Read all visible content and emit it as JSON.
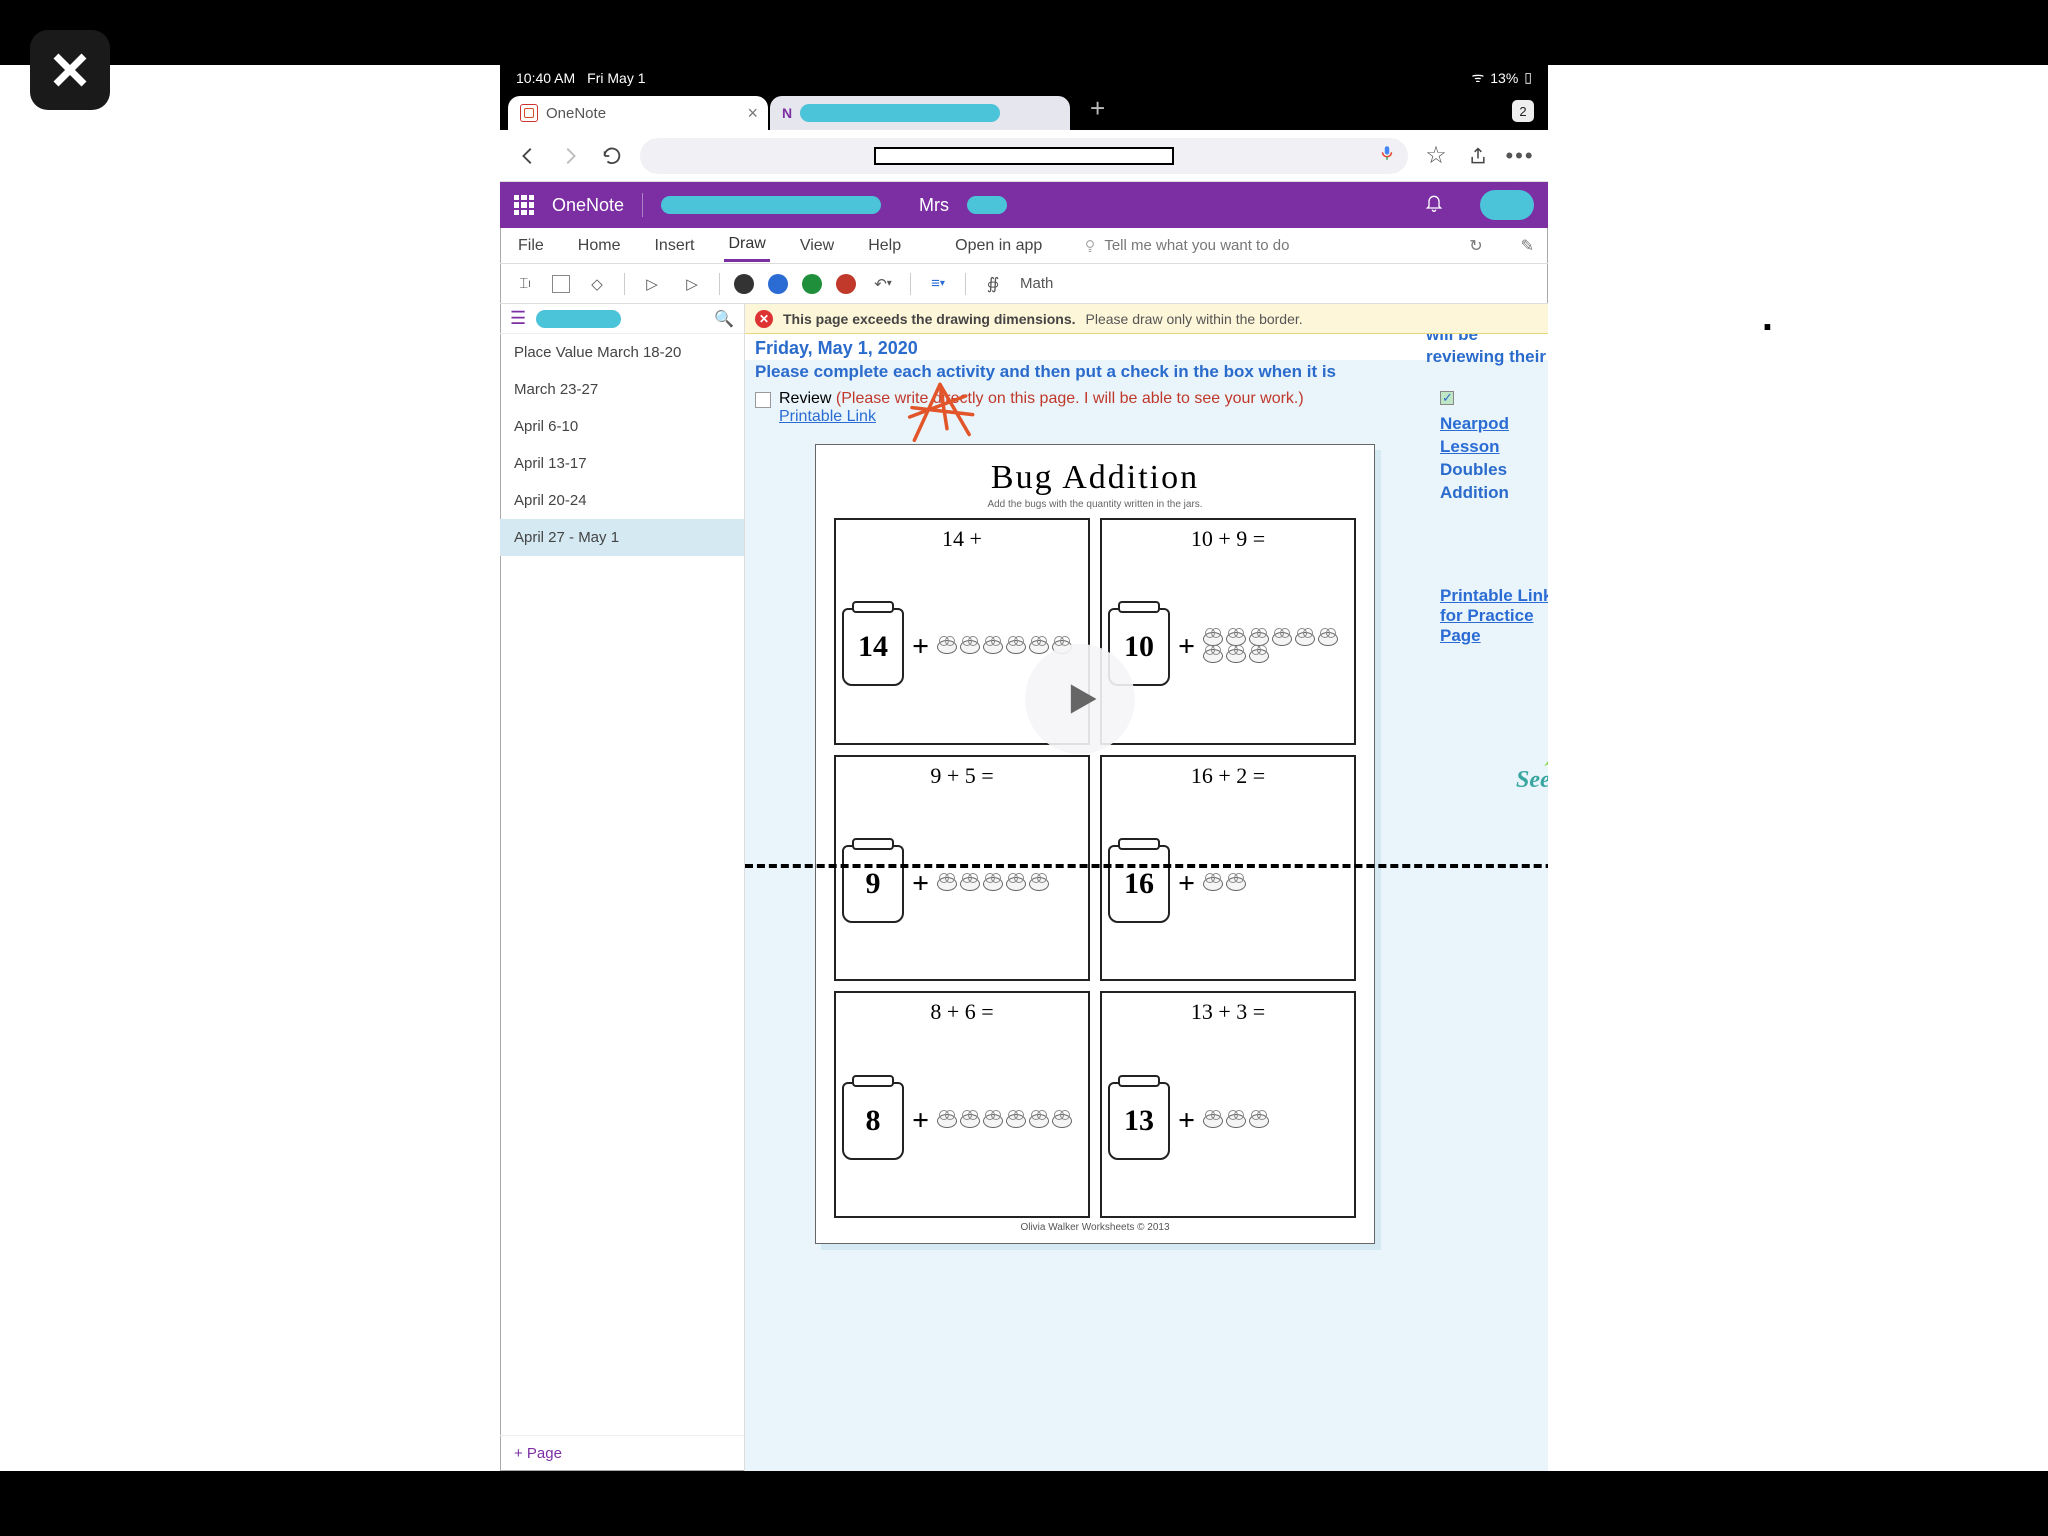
{
  "overlay": {
    "close": "×"
  },
  "statusbar": {
    "time": "10:40 AM",
    "date": "Fri May 1",
    "wifi": "13%"
  },
  "tabs": {
    "active_label": "OneNote",
    "new_tab": "+",
    "count": "2"
  },
  "urlbar": {
    "back": "←",
    "forward": "→",
    "reload": "↻",
    "star": "☆",
    "share": "⇪",
    "more": "⋯"
  },
  "ribbon": {
    "app": "OneNote",
    "breadcrumb_prefix": "Mrs"
  },
  "menus": {
    "file": "File",
    "home": "Home",
    "insert": "Insert",
    "draw": "Draw",
    "view": "View",
    "help": "Help",
    "open": "Open in app",
    "tellme": "Tell me what you want to do"
  },
  "drawbar": {
    "math": "Math"
  },
  "warning": {
    "bold": "This page exceeds the drawing dimensions.",
    "rest": "Please draw only within the border."
  },
  "sidebar": {
    "pages": [
      {
        "label": "Place Value March 18-20"
      },
      {
        "label": "March 23-27"
      },
      {
        "label": "April 6-10"
      },
      {
        "label": "April 13-17"
      },
      {
        "label": "April 20-24"
      },
      {
        "label": "April 27 - May 1",
        "sel": true
      }
    ],
    "add": "+ Page"
  },
  "note": {
    "date": "Friday, May 1, 2020",
    "instr": "Please complete each activity and then put a check in the box when it is",
    "right_top": "will be reviewing their",
    "review_label": "Review",
    "review_red": "(Please write directly on this page. I will be able to see your work.)",
    "printable": "Printable Link",
    "right1_link": "Nearpod Lesson",
    "right1_rest": "Doubles Addition",
    "right2": "Printable Link for Practice Page",
    "seesaw": "Sees"
  },
  "worksheet": {
    "title": "Bug Addition",
    "sub": "Add the bugs with the quantity written in the jars.",
    "foot": "Olivia Walker Worksheets © 2013",
    "cells": [
      {
        "eq": "14 + ",
        "jar": "14",
        "bugs": 6
      },
      {
        "eq": "10 + 9 =",
        "jar": "10",
        "bugs": 9
      },
      {
        "eq": "9 + 5 =",
        "jar": "9",
        "bugs": 5
      },
      {
        "eq": "16 + 2 =",
        "jar": "16",
        "bugs": 2
      },
      {
        "eq": "8 + 6 =",
        "jar": "8",
        "bugs": 6
      },
      {
        "eq": "13 + 3 =",
        "jar": "13",
        "bugs": 3
      }
    ]
  }
}
